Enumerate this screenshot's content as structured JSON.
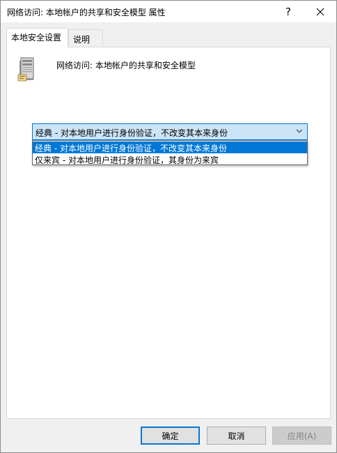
{
  "window": {
    "title": "网络访问: 本地帐户的共享和安全模型 属性",
    "help_label": "?"
  },
  "tabs": [
    {
      "label": "本地安全设置",
      "active": true
    },
    {
      "label": "说明",
      "active": false
    }
  ],
  "policy": {
    "icon": "server-policy-icon",
    "name": "网络访问: 本地帐户的共享和安全模型"
  },
  "combo": {
    "selected": "经典 - 对本地用户进行身份验证，不改变其本来身份",
    "options": [
      "经典 - 对本地用户进行身份验证，不改变其本来身份",
      "仅来宾 - 对本地用户进行身份验证，其身份为来宾"
    ]
  },
  "buttons": {
    "ok": "确定",
    "cancel": "取消",
    "apply": "应用(A)"
  },
  "colors": {
    "accent": "#0078d7",
    "selection_bg": "#cce4f7"
  }
}
